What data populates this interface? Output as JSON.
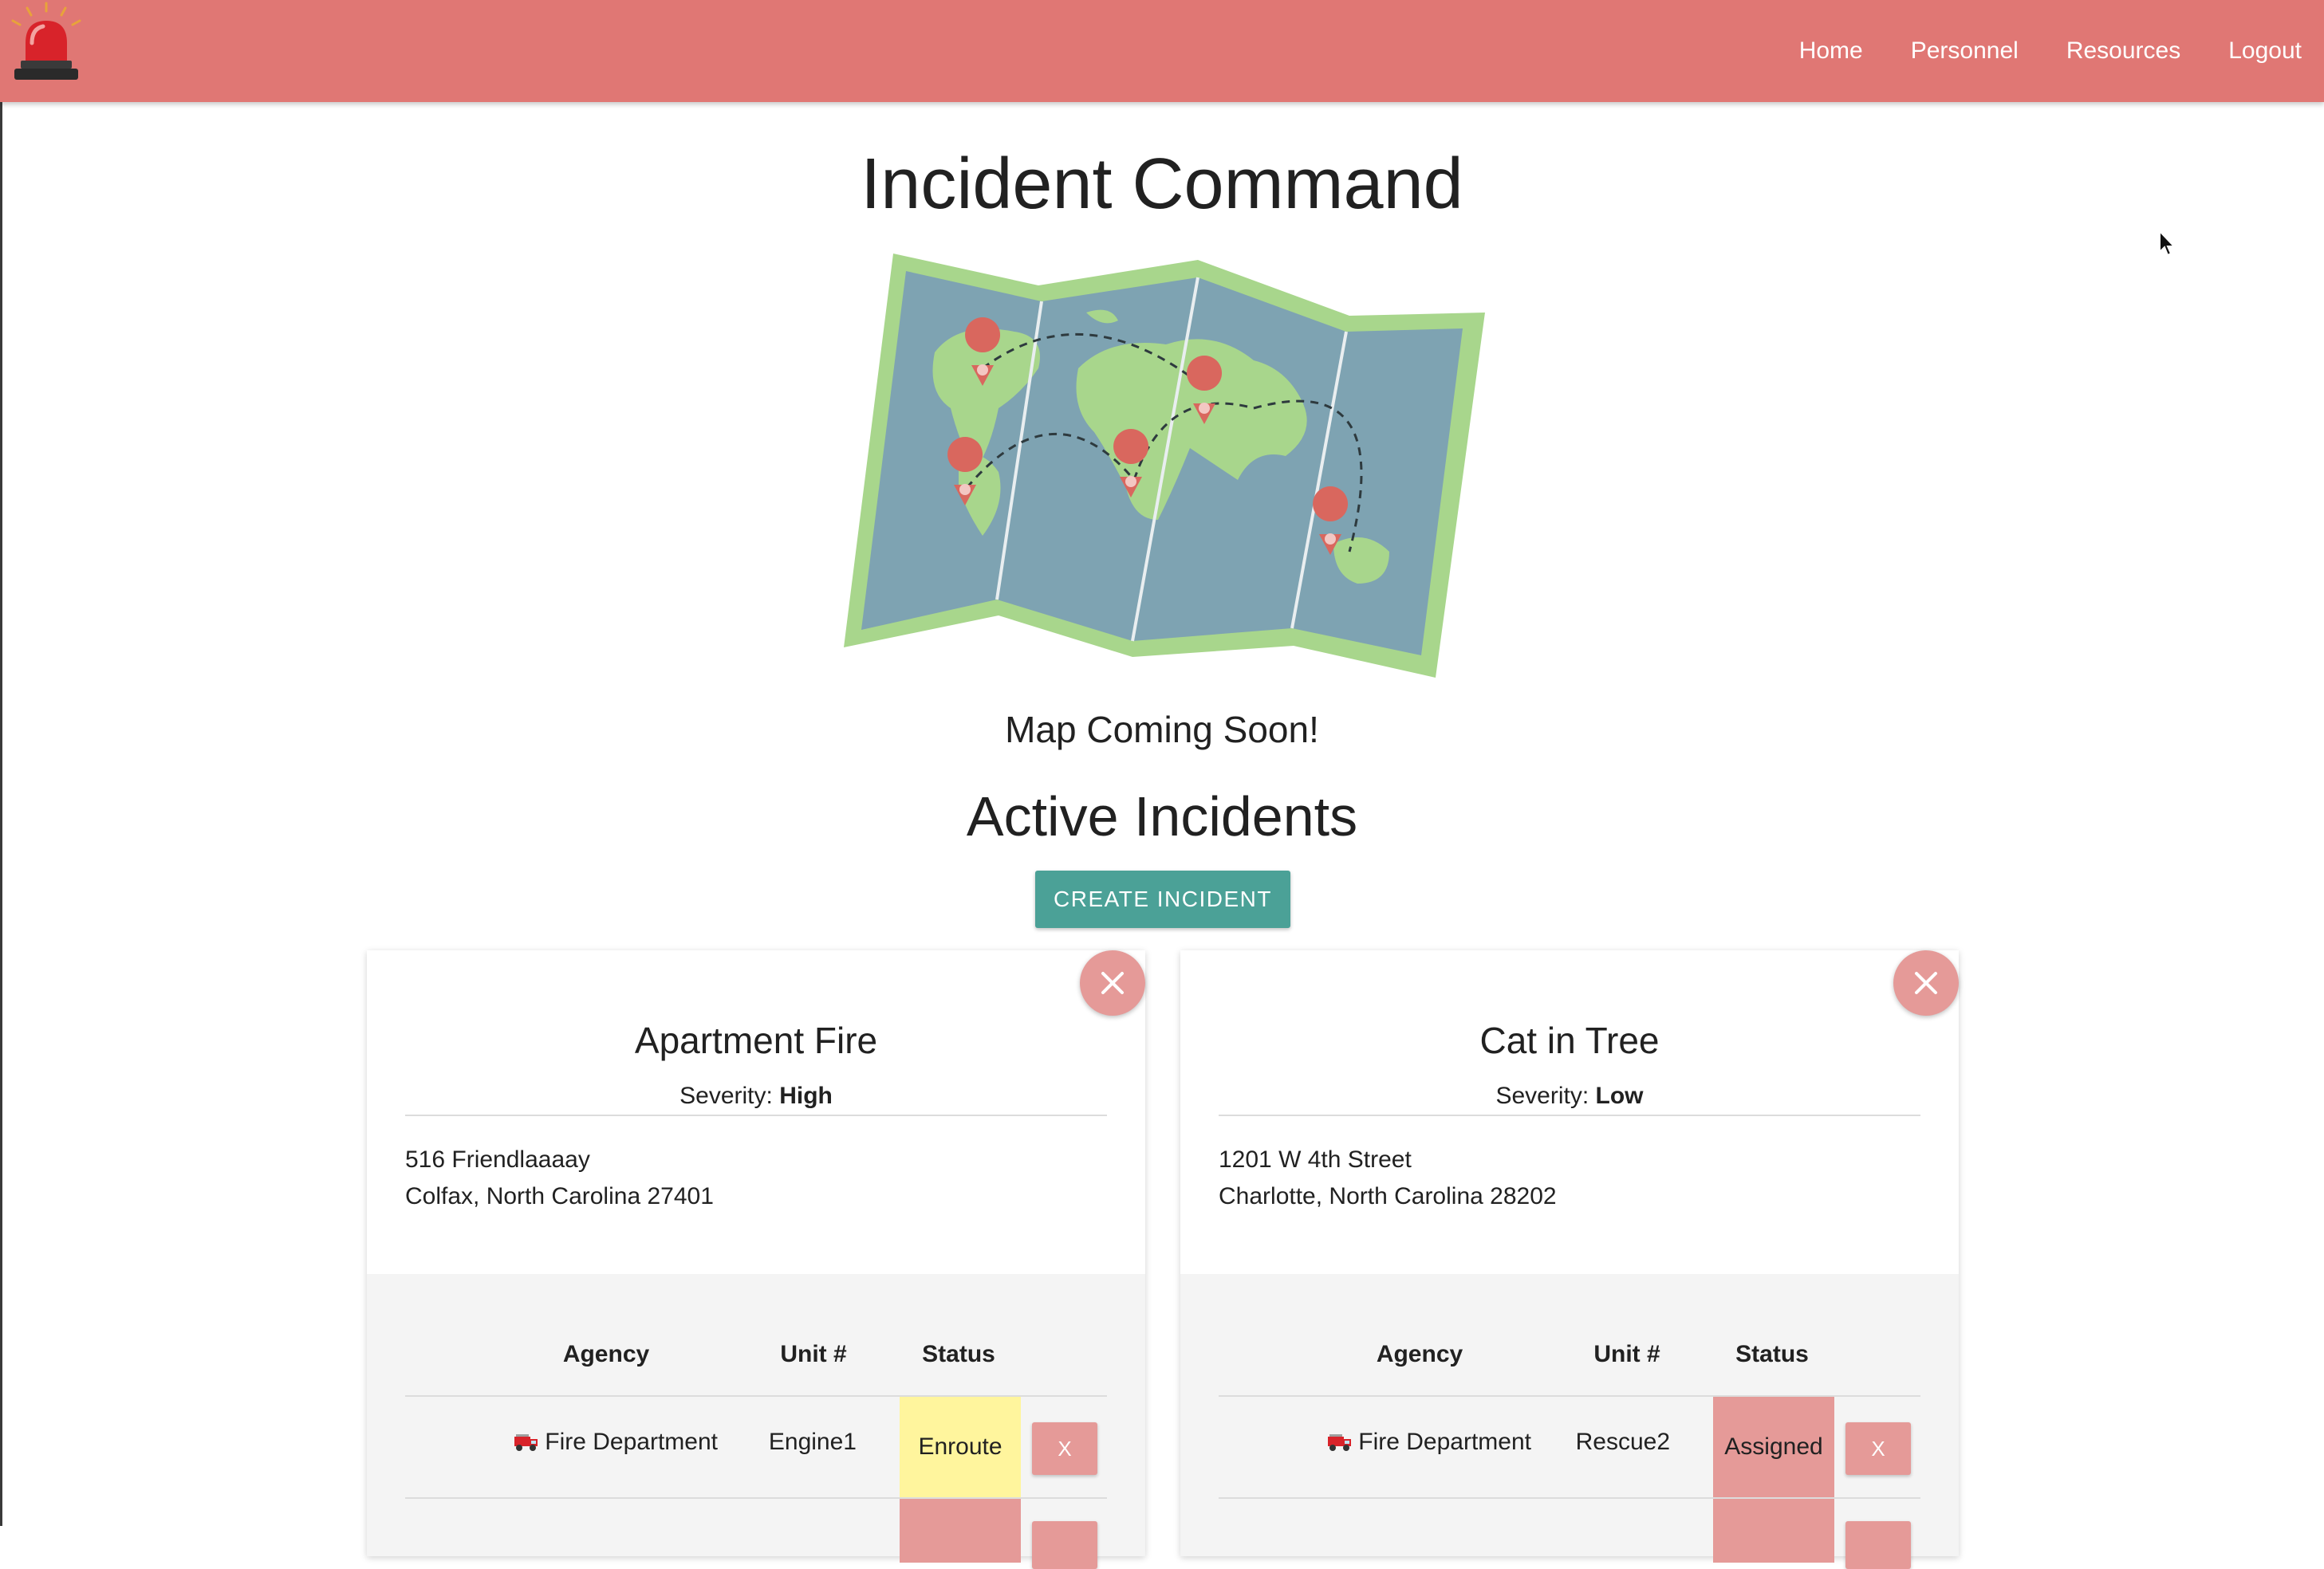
{
  "navbar": {
    "links": [
      "Home",
      "Personnel",
      "Resources",
      "Logout"
    ],
    "background": "#e07774"
  },
  "page": {
    "title": "Incident Command",
    "map_caption": "Map Coming Soon!",
    "section_title": "Active Incidents",
    "create_button": "CREATE INCIDENT"
  },
  "incidents": [
    {
      "title": "Apartment Fire",
      "severity_label": "Severity:",
      "severity": "High",
      "address_line1": "516 Friendlaaaay",
      "address_line2": "Colfax, North Carolina 27401",
      "table_headers": [
        "Agency",
        "Unit #",
        "Status"
      ],
      "rows": [
        {
          "agency": "Fire Department",
          "unit": "Engine1",
          "status": "Enroute",
          "status_color": "#fff59d",
          "remove_label": "X"
        }
      ]
    },
    {
      "title": "Cat in Tree",
      "severity_label": "Severity:",
      "severity": "Low",
      "address_line1": "1201 W 4th Street",
      "address_line2": "Charlotte, North Carolina 28202",
      "table_headers": [
        "Agency",
        "Unit #",
        "Status"
      ],
      "rows": [
        {
          "agency": "Fire Department",
          "unit": "Rescue2",
          "status": "Assigned",
          "status_color": "#e59a98",
          "remove_label": "X"
        }
      ]
    }
  ],
  "colors": {
    "accent_teal": "#4ba197",
    "remove_pink": "#e59a98",
    "enroute_yellow": "#fff59d"
  },
  "icons": [
    "siren-logo-icon",
    "close-icon",
    "fire-truck-icon",
    "mouse-cursor-icon"
  ]
}
